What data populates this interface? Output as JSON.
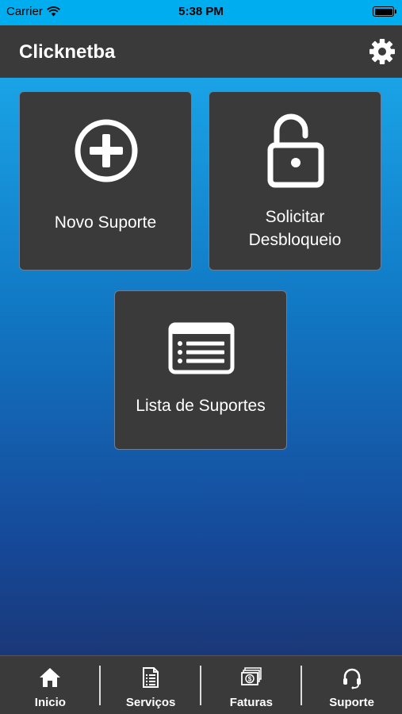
{
  "status_bar": {
    "carrier": "Carrier",
    "time": "5:38 PM"
  },
  "nav": {
    "title": "Clicknetba",
    "settings_icon": "gear-icon"
  },
  "tiles": [
    {
      "label": "Novo Suporte",
      "icon": "plus-circle-icon"
    },
    {
      "label": "Solicitar\nDesbloqueio",
      "icon": "unlock-icon"
    },
    {
      "label": "Lista de Suportes",
      "icon": "list-icon"
    }
  ],
  "tabs": [
    {
      "label": "Inicio",
      "icon": "home-icon"
    },
    {
      "label": "Serviços",
      "icon": "document-icon"
    },
    {
      "label": "Faturas",
      "icon": "money-icon"
    },
    {
      "label": "Suporte",
      "icon": "headset-icon"
    }
  ],
  "colors": {
    "status_bar": "#00aeef",
    "nav_bar": "#3b3a3a",
    "tile": "#3b3a3a",
    "gradient_top": "#1aa3e6",
    "gradient_bottom": "#1a3878"
  }
}
